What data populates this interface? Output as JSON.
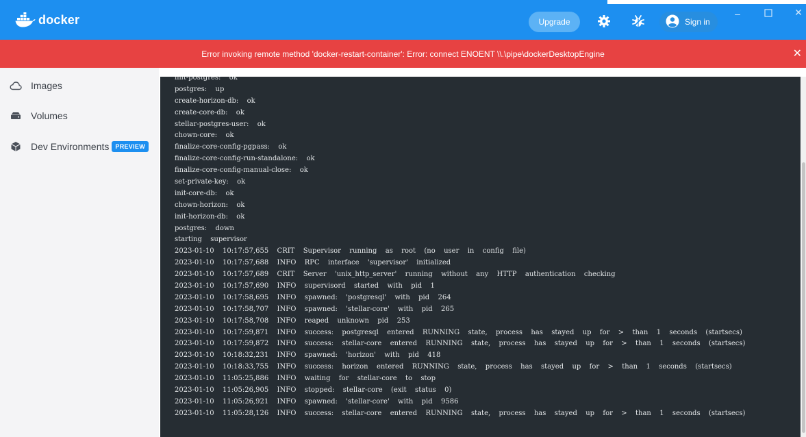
{
  "app": {
    "logo_text": "docker",
    "upgrade_label": "Upgrade",
    "signin_label": "Sign in",
    "icons": [
      "docker-whale-icon",
      "gear-icon",
      "bug-icon",
      "user-avatar-icon",
      "minimize-icon",
      "maximize-icon",
      "close-icon"
    ],
    "accent_color": "#1d8ff0",
    "error_color": "#e74242"
  },
  "error_banner": {
    "message": "Error invoking remote method 'docker-restart-container': Error: connect ENOENT \\\\.\\pipe\\dockerDesktopEngine",
    "close_glyph": "✕"
  },
  "sidebar": {
    "items": [
      {
        "label": "Images",
        "icon": "cloud-icon"
      },
      {
        "label": "Volumes",
        "icon": "disk-icon"
      },
      {
        "label": "Dev Environments",
        "icon": "cube-icon",
        "badge": "PREVIEW"
      }
    ]
  },
  "logs": [
    "init-postgres:  ok",
    "postgres:  up",
    "create-horizon-db:  ok",
    "create-core-db:  ok",
    "stellar-postgres-user:  ok",
    "chown-core:  ok",
    "finalize-core-config-pgpass:  ok",
    "finalize-core-config-run-standalone:  ok",
    "finalize-core-config-manual-close:  ok",
    "set-private-key:  ok",
    "init-core-db:  ok",
    "chown-horizon:  ok",
    "init-horizon-db:  ok",
    "postgres:  down",
    "starting  supervisor",
    "2023-01-10  10:17:57,655  CRIT  Supervisor  running  as  root  (no  user  in  config  file)",
    "2023-01-10  10:17:57,688  INFO  RPC  interface  'supervisor'  initialized",
    "2023-01-10  10:17:57,689  CRIT  Server  'unix_http_server'  running  without  any  HTTP  authentication  checking",
    "2023-01-10  10:17:57,690  INFO  supervisord  started  with  pid  1",
    "2023-01-10  10:17:58,695  INFO  spawned:  'postgresql'  with  pid  264",
    "2023-01-10  10:17:58,707  INFO  spawned:  'stellar-core'  with  pid  265",
    "2023-01-10  10:17:58,708  INFO  reaped  unknown  pid  253",
    "2023-01-10  10:17:59,871  INFO  success:  postgresql  entered  RUNNING  state,  process  has  stayed  up  for  >  than  1  seconds  (startsecs)",
    "2023-01-10  10:17:59,872  INFO  success:  stellar-core  entered  RUNNING  state,  process  has  stayed  up  for  >  than  1  seconds  (startsecs)",
    "2023-01-10  10:18:32,231  INFO  spawned:  'horizon'  with  pid  418",
    "2023-01-10  10:18:33,755  INFO  success:  horizon  entered  RUNNING  state,  process  has  stayed  up  for  >  than  1  seconds  (startsecs)",
    "2023-01-10  11:05:25,886  INFO  waiting  for  stellar-core  to  stop",
    "2023-01-10  11:05:26,905  INFO  stopped:  stellar-core  (exit  status  0)",
    "2023-01-10  11:05:26,921  INFO  spawned:  'stellar-core'  with  pid  9586",
    "2023-01-10  11:05:28,126  INFO  success:  stellar-core  entered  RUNNING  state,  process  has  stayed  up  for  >  than  1  seconds  (startsecs)"
  ]
}
